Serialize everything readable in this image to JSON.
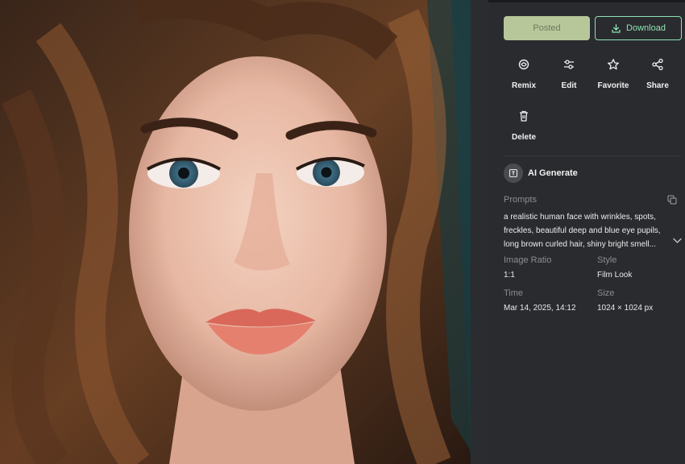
{
  "image": {
    "alt_icon": "portrait-image"
  },
  "buttons": {
    "posted_label": "Posted",
    "download_label": "Download",
    "download_icon": "download-icon"
  },
  "actions": [
    {
      "label": "Remix",
      "icon": "remix-icon"
    },
    {
      "label": "Edit",
      "icon": "sliders-icon"
    },
    {
      "label": "Favorite",
      "icon": "star-icon"
    },
    {
      "label": "Share",
      "icon": "share-icon"
    },
    {
      "label": "Delete",
      "icon": "trash-icon"
    }
  ],
  "generator": {
    "title": "AI Generate",
    "icon": "ai-generate-icon"
  },
  "prompts": {
    "label": "Prompts",
    "text": "a realistic human face with wrinkles, spots, freckles, beautiful deep and blue eye pupils, long brown curled hair, shiny bright smell..."
  },
  "details": {
    "ratio_label": "Image Ratio",
    "ratio_value": "1:1",
    "style_label": "Style",
    "style_value": "Film Look",
    "time_label": "Time",
    "time_value": "Mar 14, 2025, 14:12",
    "size_label": "Size",
    "size_value": "1024 × 1024 px"
  },
  "colors": {
    "accent_green": "#8ee3b4",
    "posted_bg": "#b7c79a",
    "panel_bg": "#2a2b2f"
  }
}
